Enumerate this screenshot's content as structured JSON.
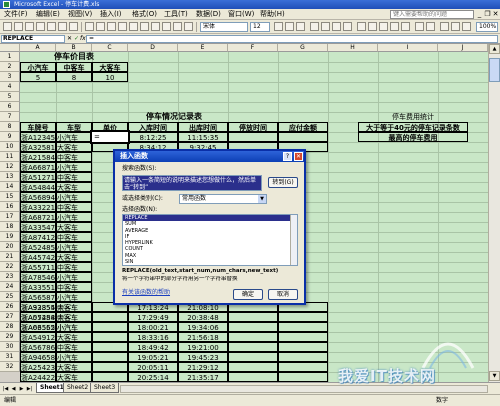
{
  "window": {
    "title": "Microsoft Excel - 停车计费.xls",
    "help_placeholder": "键入需要帮助的问题",
    "controls": [
      "_",
      "❐",
      "✕"
    ]
  },
  "menu": [
    "文件(F)",
    "编辑(E)",
    "视图(V)",
    "插入(I)",
    "格式(O)",
    "工具(T)",
    "数据(D)",
    "窗口(W)",
    "帮助(H)"
  ],
  "toolbar": {
    "font_name": "宋体",
    "font_size": "12",
    "zoom": "100%"
  },
  "formula_bar": {
    "name_box": "REPLACE",
    "fx_label": "fx",
    "formula": "="
  },
  "columns": [
    "A",
    "B",
    "C",
    "D",
    "E",
    "F",
    "G",
    "H",
    "I",
    "J"
  ],
  "rows": [
    "1",
    "2",
    "3",
    "4",
    "5",
    "6",
    "7",
    "8",
    "9",
    "10",
    "11",
    "12",
    "13",
    "14",
    "15",
    "16",
    "17",
    "18",
    "19",
    "20",
    "21",
    "22",
    "23",
    "24",
    "25",
    "26",
    "27",
    "28",
    "29",
    "30",
    "31",
    "32"
  ],
  "sheet": {
    "price_table": {
      "title": "停车价目表",
      "headers": [
        "小汽车",
        "中客车",
        "大客车"
      ],
      "values": [
        "5",
        "8",
        "10"
      ]
    },
    "record_title": "停车情况记录表",
    "record_headers": [
      "车牌号",
      "车型",
      "单价",
      "入库时间",
      "出库时间",
      "停放时间",
      "应付金额"
    ],
    "first_rows": [
      {
        "plate": "浙A12345",
        "type": "小汽车",
        "price": "=",
        "in": "8:12:25",
        "out": "11:15:35"
      },
      {
        "plate": "浙A32581",
        "type": "大客车",
        "price": "",
        "in": "8:34:12",
        "out": "9:32:45"
      }
    ],
    "hidden_plates": [
      [
        "浙A21584",
        "中客车"
      ],
      [
        "浙A66871",
        "小汽车"
      ],
      [
        "浙A51271",
        "中客车"
      ],
      [
        "浙A54844",
        "大客车"
      ],
      [
        "浙A56894",
        "小汽车"
      ],
      [
        "浙A33221",
        "中客车"
      ],
      [
        "浙A68721",
        "小汽车"
      ],
      [
        "浙A33547",
        "大客车"
      ],
      [
        "浙A87412",
        "中客车"
      ],
      [
        "浙A52485",
        "小汽车"
      ],
      [
        "浙A45742",
        "大客车"
      ],
      [
        "浙A55711",
        "中客车"
      ],
      [
        "浙A78546",
        "小汽车"
      ],
      [
        "浙A33551",
        "中客车"
      ],
      [
        "浙A56587",
        "小汽车"
      ],
      [
        "浙A93355",
        "中客车"
      ],
      [
        "浙A05258",
        "大客车"
      ],
      [
        "浙A03552",
        "小汽车"
      ]
    ],
    "bottom_rows": [
      {
        "plate": "浙A32854",
        "type": "大客车",
        "in": "17:13:24",
        "out": "21:08:10"
      },
      {
        "plate": "浙A57484",
        "type": "中客车",
        "in": "17:29:49",
        "out": "20:38:48"
      },
      {
        "plate": "浙A66565",
        "type": "小汽车",
        "in": "18:00:21",
        "out": "19:34:06"
      },
      {
        "plate": "浙A54912",
        "type": "大客车",
        "in": "18:33:16",
        "out": "21:56:18"
      },
      {
        "plate": "浙A56786",
        "type": "中客车",
        "in": "18:49:42",
        "out": "19:21:00"
      },
      {
        "plate": "浙A94658",
        "type": "小汽车",
        "in": "19:05:21",
        "out": "19:45:23"
      },
      {
        "plate": "浙A25423",
        "type": "大客车",
        "in": "20:05:11",
        "out": "21:29:12"
      },
      {
        "plate": "浙A24422",
        "type": "大客车",
        "in": "20:25:14",
        "out": "21:35:17"
      },
      {
        "plate": "浙A23355",
        "type": "中客车",
        "in": "20:54:43",
        "out": "22:13:12"
      }
    ],
    "stats": {
      "title": "停车费用统计",
      "row1": "大于等于40元的停车记录条数",
      "row2": "最高的停车费用"
    }
  },
  "dialog": {
    "title": "插入函数",
    "search_label": "搜索函数(S):",
    "search_text": "请输入一条简短的说明来描述您想做什么，然后单击“转到”",
    "go_button": "转到(G)",
    "category_label": "或选择类别(C):",
    "category_value": "常用函数",
    "function_list_label": "选择函数(N):",
    "functions": [
      "REPLACE",
      "SUM",
      "AVERAGE",
      "IF",
      "HYPERLINK",
      "COUNT",
      "MAX",
      "SIN"
    ],
    "selected_function": "REPLACE",
    "signature": "REPLACE(old_text,start_num,num_chars,new_text)",
    "description": "将一个字符串中的部分字符用另一个字符串替换",
    "help_link": "有关该函数的帮助",
    "ok_button": "确定",
    "cancel_button": "取消"
  },
  "sheet_tabs": [
    "Sheet1",
    "Sheet2",
    "Sheet3"
  ],
  "status": {
    "mode": "编辑",
    "right": "数字"
  },
  "watermark": "我爱IT技术网"
}
